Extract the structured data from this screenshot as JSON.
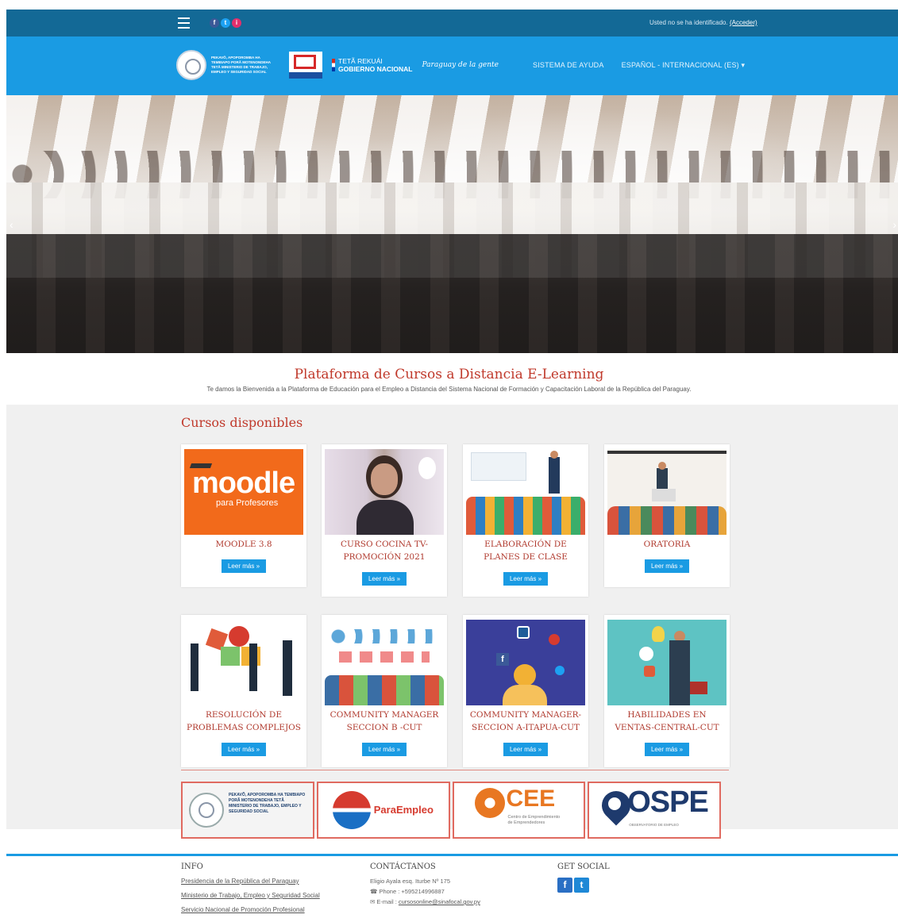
{
  "topbar": {
    "login_text": "Usted no se ha identificado.",
    "login_link": "(Acceder)",
    "social": [
      "f",
      "t",
      "i"
    ]
  },
  "header": {
    "logos": {
      "mtess": "PEKAVÕ, APOPOROMBA HA TEMBIAPO PORÃ MOTENONDEHA TETÃ MINISTERIO DE TRABAJO, EMPLEO Y SEGURIDAD SOCIAL",
      "snpp": "SINAFOCAL",
      "teta_line1": "TETÃ REKUÁI",
      "teta_line2": "GOBIERNO NACIONAL",
      "script": "Paraguay de la gente"
    },
    "nav": {
      "help": "SISTEMA DE AYUDA",
      "lang": "ESPAÑOL - INTERNACIONAL (ES)"
    }
  },
  "welcome": {
    "title": "Plataforma de Cursos a Distancia E-Learning",
    "subtitle": "Te damos la Bienvenida a la Plataforma de Educación para el Empleo a Distancia del Sistema Nacional de Formación y Capacitación Laboral de la República del Paraguay."
  },
  "courses": {
    "title": "Cursos disponibles",
    "button_label": "Leer más",
    "items": [
      {
        "name": "MOODLE 3.8",
        "thumb_text": "moodle",
        "thumb_sub": "para Profesores"
      },
      {
        "name": "CURSO COCINA TV-PROMOCIÓN 2021"
      },
      {
        "name": "ELABORACIÓN DE PLANES DE CLASE"
      },
      {
        "name": "ORATORIA"
      },
      {
        "name": "RESOLUCIÓN DE PROBLEMAS COMPLEJOS"
      },
      {
        "name": "COMMUNITY MANAGER SECCION B -CUT"
      },
      {
        "name": "COMMUNITY MANAGER-SECCION A-ITAPUA-CUT"
      },
      {
        "name": "HABILIDADES EN VENTAS-CENTRAL-CUT"
      }
    ]
  },
  "partners": {
    "paraempleo": "ParaEmpleo",
    "cee": "CEE",
    "cee_sub": "Centro de Emprendimiento de Emprendedores",
    "ospe": "OSPE",
    "ospe_sub": "OBSERVATORIO DE EMPLEO"
  },
  "footer": {
    "info_title": "INFO",
    "info_links": [
      "Presidencia de la República del Paraguay",
      "Ministerio de Trabajo, Empleo y Seguridad Social",
      "Servicio Nacional de Promoción Profesional"
    ],
    "contact_title": "CONTÁCTANOS",
    "address": "Eligio Ayala esq. Iturbe Nº 175",
    "phone": "Phone : +595214996887",
    "email_label": "E-mail : ",
    "email": "cursosonline@sinafocal.gov.py",
    "social_title": "GET SOCIAL"
  }
}
